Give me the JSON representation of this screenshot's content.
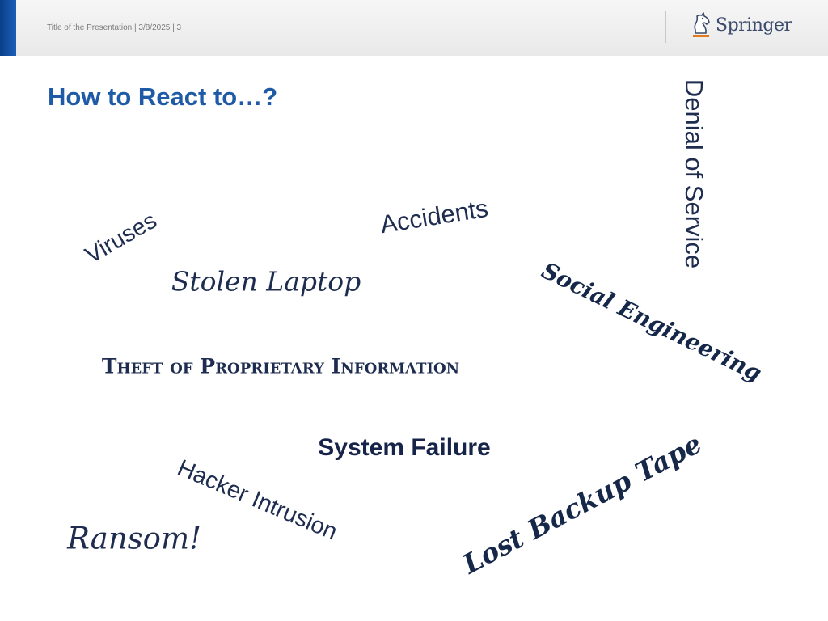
{
  "header": {
    "slide_info": "Title of the Presentation | 3/8/2025 | 3",
    "logo_text": "Springer",
    "logo_icon": "springer-horse-icon"
  },
  "slide": {
    "title": "How to React to…?",
    "words": {
      "denial_of_service": "Denial of Service",
      "accidents": "Accidents",
      "viruses": "Viruses",
      "stolen_laptop": "Stolen Laptop",
      "social_engineering": "Social Engineering",
      "theft": "Theft of Proprietary Information",
      "system_failure": "System Failure",
      "hacker_intrusion": "Hacker Intrusion",
      "lost_backup_tape": "Lost Backup Tape",
      "ransom": "Ransom!"
    }
  },
  "colors": {
    "title_blue": "#1f5aa6",
    "accent_blue": "#0a3f8a",
    "logo_orange": "#e07a1f",
    "word_navy": "#1d2c4f"
  }
}
